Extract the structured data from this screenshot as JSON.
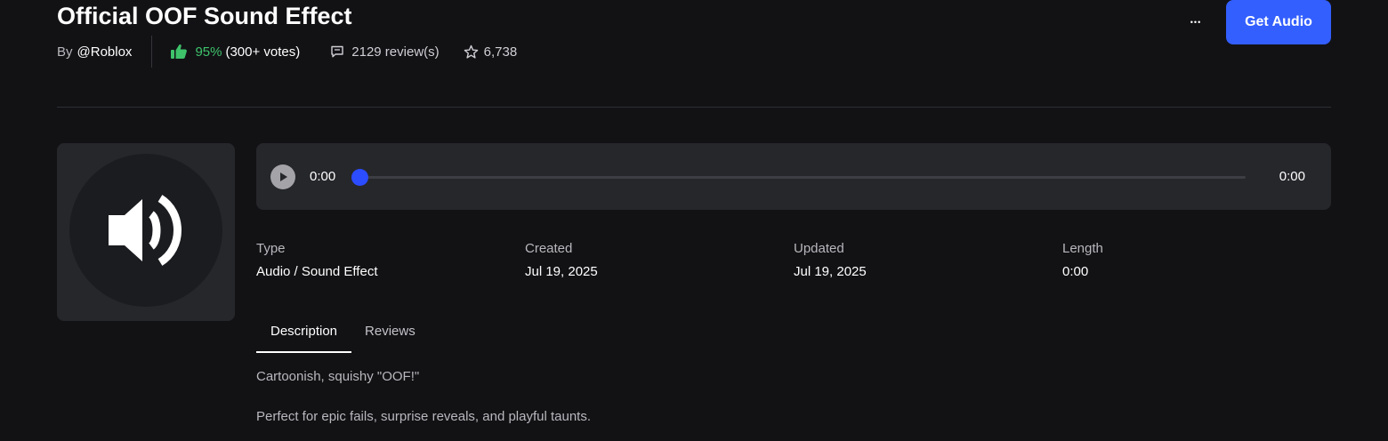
{
  "asset": {
    "title": "Official OOF Sound Effect",
    "by_prefix": "By",
    "creator": "@Roblox",
    "vote_percent": "95%",
    "vote_count": "(300+ votes)",
    "reviews": "2129 review(s)",
    "favorites": "6,738"
  },
  "actions": {
    "more_label": "•••",
    "get_button_label": "Get Audio"
  },
  "thumbnail": {
    "icon": "speaker-volume-icon"
  },
  "player": {
    "current_time": "0:00",
    "total_time": "0:00",
    "progress": 0
  },
  "details": [
    {
      "label": "Type",
      "value": "Audio / Sound Effect"
    },
    {
      "label": "Created",
      "value": "Jul 19, 2025"
    },
    {
      "label": "Updated",
      "value": "Jul 19, 2025"
    },
    {
      "label": "Length",
      "value": "0:00"
    }
  ],
  "tabs": [
    {
      "label": "Description",
      "active": true
    },
    {
      "label": "Reviews",
      "active": false
    }
  ],
  "description": {
    "line1": "Cartoonish, squishy \"OOF!\"",
    "line2": "Perfect for epic fails, surprise reveals, and playful taunts."
  },
  "colors": {
    "background": "#121215",
    "card": "#26272b",
    "accent": "#335fff",
    "vote_green": "#3ec26a"
  }
}
